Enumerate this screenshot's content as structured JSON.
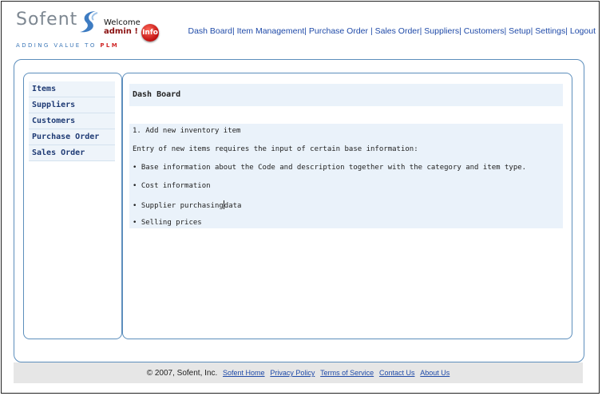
{
  "header": {
    "logo_text": "Sofent",
    "tagline_prefix": "ADDING VALUE TO",
    "tagline_plm": "PLM",
    "welcome_label": "Welcome",
    "username": "admin !",
    "info_label": "Info"
  },
  "topnav": {
    "items": [
      "Dash Board",
      "Item Management",
      "Purchase Order",
      "Sales Order",
      "Suppliers",
      "Customers",
      "Setup",
      "Settings",
      "Logout"
    ]
  },
  "sidebar": {
    "items": [
      {
        "label": "Items"
      },
      {
        "label": "Suppliers"
      },
      {
        "label": "Customers"
      },
      {
        "label": "Purchase Order"
      },
      {
        "label": "Sales Order"
      }
    ]
  },
  "main": {
    "title": "Dash Board",
    "lines": [
      "1. Add new inventory item",
      "Entry of new items requires the input of certain base information:",
      "• Base information about the Code and description together with the category and item type.",
      "• Cost information",
      "• Supplier purchasing",
      "data",
      "• Selling prices"
    ]
  },
  "footer": {
    "copyright": "© 2007, Sofent, Inc.",
    "links": [
      "Sofent Home",
      "Privacy Policy",
      "Terms of Service",
      "Contact Us",
      "About Us"
    ]
  },
  "colors": {
    "nav_link": "#1f4aa8",
    "border": "#5c8ebc",
    "panel_bg": "#eaf2fa",
    "footer_bg": "#e6e6e6",
    "info_red": "#c01010"
  }
}
